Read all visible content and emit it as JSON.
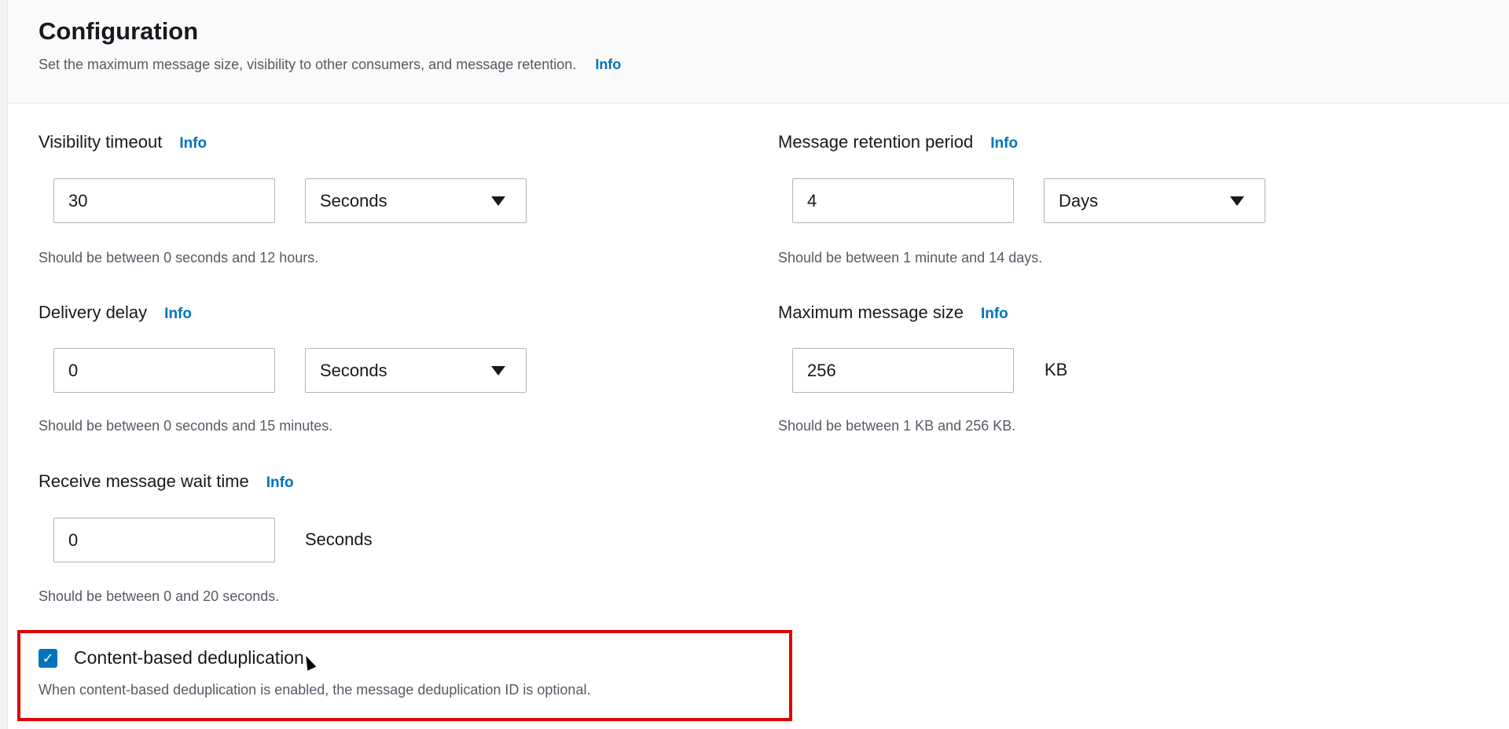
{
  "section": {
    "title": "Configuration",
    "subtitle": "Set the maximum message size, visibility to other consumers, and message retention.",
    "info": "Info"
  },
  "fields": {
    "visibility": {
      "label": "Visibility timeout",
      "info": "Info",
      "value": "30",
      "unit": "Seconds",
      "hint": "Should be between 0 seconds and 12 hours."
    },
    "retention": {
      "label": "Message retention period",
      "info": "Info",
      "value": "4",
      "unit": "Days",
      "hint": "Should be between 1 minute and 14 days."
    },
    "delay": {
      "label": "Delivery delay",
      "info": "Info",
      "value": "0",
      "unit": "Seconds",
      "hint": "Should be between 0 seconds and 15 minutes."
    },
    "maxsize": {
      "label": "Maximum message size",
      "info": "Info",
      "value": "256",
      "unit": "KB",
      "hint": "Should be between 1 KB and 256 KB."
    },
    "wait": {
      "label": "Receive message wait time",
      "info": "Info",
      "value": "0",
      "unit": "Seconds",
      "hint": "Should be between 0 and 20 seconds."
    }
  },
  "dedup": {
    "label": "Content-based deduplication",
    "checked": true,
    "description": "When content-based deduplication is enabled, the message deduplication ID is optional."
  },
  "colors": {
    "accent": "#0073bb",
    "highlight": "#e00000"
  }
}
